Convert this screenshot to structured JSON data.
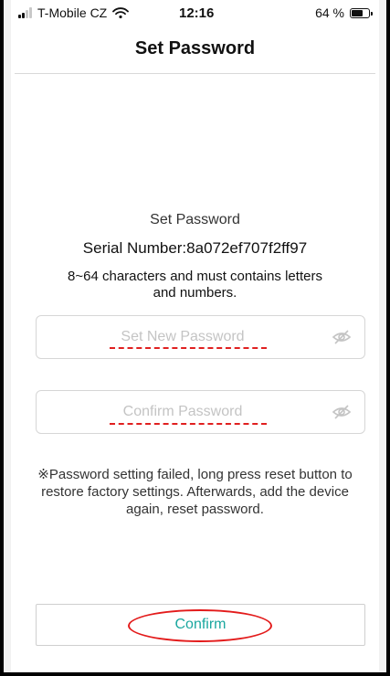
{
  "status_bar": {
    "carrier": "T-Mobile CZ",
    "time": "12:16",
    "battery_text": "64 %",
    "battery_level": 0.64,
    "signal_bars_active": 2,
    "signal_bars_total": 4
  },
  "nav": {
    "title": "Set Password"
  },
  "form": {
    "heading": "Set Password",
    "serial": "Serial Number:8a072ef707f2ff97",
    "hint": "8~64 characters and must contains letters and numbers.",
    "new_password": {
      "placeholder": "Set New Password",
      "value": "",
      "icon": "eye-hidden-icon"
    },
    "confirm_password": {
      "placeholder": "Confirm Password",
      "value": "",
      "icon": "eye-hidden-icon"
    },
    "notice": "※Password setting failed, long press reset button to restore factory settings. Afterwards, add the device again, reset password."
  },
  "confirm_button": {
    "label": "Confirm"
  },
  "colors": {
    "accent": "#1aa79f",
    "annotation": "#e31b1b",
    "border": "#d6d6d6"
  }
}
